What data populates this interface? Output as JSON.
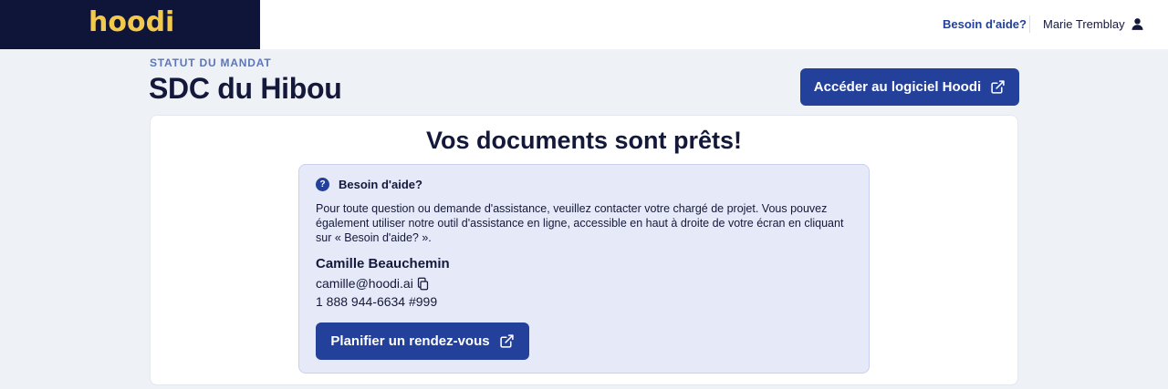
{
  "header": {
    "logo_text": "hoodi",
    "help_link": "Besoin d'aide?",
    "user_name": "Marie Tremblay",
    "user_icon": "person-icon"
  },
  "page": {
    "status_label": "STATUT DU MANDAT",
    "title": "SDC du Hibou",
    "access_button": "Accéder au logiciel Hoodi",
    "access_button_icon": "external-link-icon"
  },
  "card": {
    "title": "Vos documents sont prêts!",
    "help": {
      "icon": "question-icon",
      "icon_glyph": "?",
      "title": "Besoin d'aide?",
      "text": "Pour toute question ou demande d'assistance, veuillez contacter votre chargé de projet. Vous pouvez également utiliser notre outil d'assistance en ligne, accessible en haut à droite de votre écran en cliquant sur « Besoin d'aide? ».",
      "contact_name": "Camille Beauchemin",
      "contact_email": "camille@hoodi.ai",
      "copy_icon": "copy-icon",
      "contact_phone": "1 888 944-6634 #999",
      "schedule_button": "Planifier un rendez-vous",
      "schedule_button_icon": "external-link-icon"
    }
  },
  "colors": {
    "brand_dark": "#0f1539",
    "brand_yellow": "#f2c94c",
    "primary": "#23409b",
    "page_bg": "#eef1f6",
    "help_bg": "#e6eaf8"
  }
}
